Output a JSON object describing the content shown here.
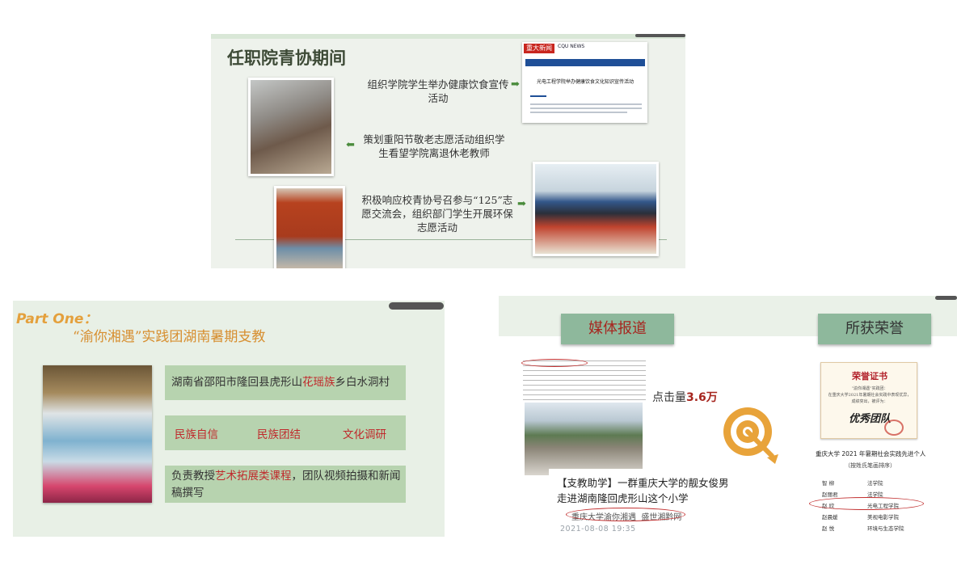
{
  "slide1": {
    "title": "任职院青协期间",
    "items": [
      {
        "text": "组织学院学生举办健康饮食宣传活动"
      },
      {
        "text": "策划重阳节敬老志愿活动组织学生看望学院离退休老教师"
      },
      {
        "text": "积极响应校青协号召参与“125”志愿交流会，组织部门学生开展环保志愿活动"
      }
    ],
    "news": {
      "logo": "重大新闻网",
      "logo_sub": "CQU NEWS",
      "headline": "光电工程学院举办健康饮食文化知识宣传活动"
    },
    "icons": {
      "arrow": "arrow-right-icon",
      "arrow_left": "arrow-left-icon"
    },
    "colors": {
      "background": "#eef2ec",
      "title": "#3d4a36",
      "arrow": "#4a8c3c"
    }
  },
  "slide2": {
    "part_label": "Part One：",
    "title": "“渝你湘遇”实践团湖南暑期支教",
    "location": {
      "pre": "湖南省邵阳市隆回县虎形山",
      "highlight": "花瑶族",
      "post": "乡白水洞村"
    },
    "themes": [
      "民族自信",
      "民族团结",
      "文化调研"
    ],
    "duty": {
      "pre": "负责教授",
      "highlight": "艺术拓展类课程",
      "post": "，团队视频拍摄和新闻稿撰写"
    },
    "colors": {
      "background": "#e8f0e6",
      "tag": "#b7d3af",
      "accent": "#c0282b",
      "title": "#d78e2f"
    }
  },
  "slide3": {
    "media_button": "媒体报道",
    "honor_button": "所获荣誉",
    "clicks_label": "点击量",
    "clicks_value": "3.6万",
    "article_title": "【支教助学】一群重庆大学的靓女俊男走进湖南隆回虎形山这个小学",
    "article_source": "重庆大学渝你湘遇",
    "article_publisher": "盛世湘黔网",
    "article_date": "2021-08-08 19:35",
    "certificate": {
      "title": "荣誉证书",
      "line1": "“渝你湘遇”实践团：",
      "line2": "在重庆大学2021年暑期社会实践中表现优异，",
      "line3": "成绩突出，被评为：",
      "team": "优秀团队"
    },
    "list_title": "重庆大学  2021 年暑期社会实践先进个人",
    "list_subtitle": "（按姓氏笔画排序）",
    "list_rows": [
      {
        "name": "智  柳",
        "college": "法学院"
      },
      {
        "name": "赵丽君",
        "college": "法学院"
      },
      {
        "name": "赵  欣",
        "college": "光电工程学院"
      },
      {
        "name": "赵晨媛",
        "college": "美视电影学院"
      },
      {
        "name": "赵  悦",
        "college": "环境与生态学院"
      }
    ],
    "icons": {
      "target": "target-icon"
    },
    "colors": {
      "button": "#8eb89c",
      "media_text": "#a6261f",
      "target": "#e8a33a",
      "ellipse": "#c23030"
    }
  }
}
